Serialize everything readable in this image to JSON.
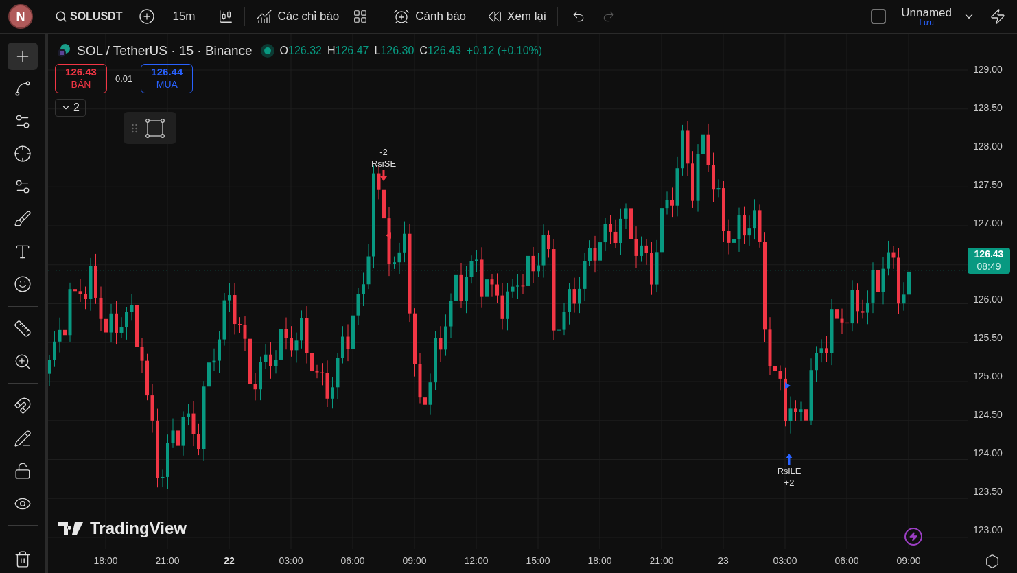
{
  "top_bar": {
    "avatar": "N",
    "symbol": "SOLUSDT",
    "interval": "15m",
    "indicators": "Các chỉ báo",
    "alerts": "Cảnh báo",
    "replay": "Xem lại",
    "undo": {
      "disabled": false
    },
    "redo": {
      "disabled": true
    },
    "layout_name": "Unnamed",
    "save": "Lưu"
  },
  "left_toolbar": [
    {
      "kind": "crosshair",
      "selected": true
    },
    {
      "kind": "trendline",
      "selected": false
    },
    {
      "kind": "hlines",
      "selected": false
    },
    {
      "kind": "pattern",
      "selected": false
    },
    {
      "kind": "fib",
      "selected": false
    },
    {
      "kind": "brush",
      "selected": false
    },
    {
      "kind": "text",
      "selected": false
    },
    {
      "kind": "emoji",
      "selected": false
    },
    {
      "kind": "ruler",
      "selected": false
    },
    {
      "kind": "zoom",
      "selected": false
    },
    {
      "kind": "magnet",
      "selected": false
    },
    {
      "kind": "drawlock",
      "selected": false
    },
    {
      "kind": "lock",
      "selected": false
    },
    {
      "kind": "eye",
      "selected": false
    },
    {
      "kind": "trash",
      "selected": false
    }
  ],
  "legend": {
    "title": "SOL / TetherUS · 15 · Binance",
    "ohlc": [
      {
        "label": "O",
        "value": "126.32"
      },
      {
        "label": "H",
        "value": "126.47"
      },
      {
        "label": "L",
        "value": "126.30"
      },
      {
        "label": "C",
        "value": "126.43"
      }
    ],
    "change": "+0.12 (+0.10%)"
  },
  "trade": {
    "sell": {
      "price": "126.43",
      "label": "BÁN"
    },
    "spread": "0.01",
    "buy": {
      "price": "126.44",
      "label": "MUA"
    }
  },
  "collapsed_count": "2",
  "signals": [
    {
      "kind": "short",
      "lines": [
        "-2",
        "RsiSE"
      ]
    },
    {
      "kind": "long",
      "lines": [
        "RsiLE",
        "+2"
      ]
    }
  ],
  "logo": "TradingView",
  "price_axis": {
    "labels_above": [
      "129.00",
      "128.50",
      "128.00",
      "127.50",
      "127.00"
    ],
    "current": {
      "price": "126.43",
      "time": "08:49"
    },
    "labels_below": [
      "126.00",
      "125.50",
      "125.00",
      "124.50",
      "124.00",
      "123.50",
      "123.00"
    ]
  },
  "time_axis": [
    {
      "text": "18:00",
      "bold": false
    },
    {
      "text": "21:00",
      "bold": false
    },
    {
      "text": "22",
      "bold": true
    },
    {
      "text": "03:00",
      "bold": false
    },
    {
      "text": "06:00",
      "bold": false
    },
    {
      "text": "09:00",
      "bold": false
    },
    {
      "text": "12:00",
      "bold": false
    },
    {
      "text": "15:00",
      "bold": false
    },
    {
      "text": "18:00",
      "bold": false
    },
    {
      "text": "21:00",
      "bold": false
    },
    {
      "text": "23",
      "bold": false
    },
    {
      "text": "03:00",
      "bold": false
    },
    {
      "text": "06:00",
      "bold": false
    },
    {
      "text": "09:00",
      "bold": false
    }
  ]
}
